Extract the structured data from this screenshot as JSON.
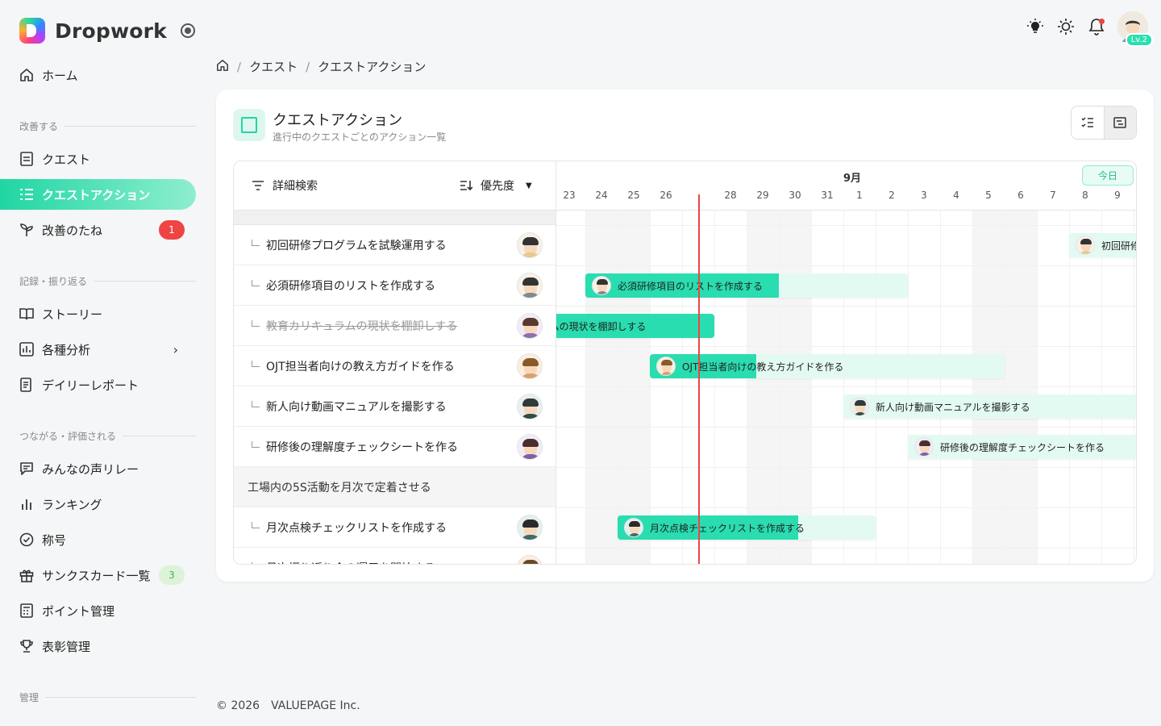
{
  "app": {
    "name": "Dropwork"
  },
  "nav": {
    "home": "ホーム",
    "section_improve": "改善する",
    "quest": "クエスト",
    "quest_action": "クエストアクション",
    "seeds": "改善のたね",
    "seeds_badge": "1",
    "section_record": "記録・振り返る",
    "story": "ストーリー",
    "analysis": "各種分析",
    "daily_report": "デイリーレポート",
    "section_connect": "つながる・評価される",
    "voice_relay": "みんなの声リレー",
    "ranking": "ランキング",
    "title": "称号",
    "thanks_list": "サンクスカード一覧",
    "thanks_badge": "3",
    "points": "ポイント管理",
    "awards": "表彰管理",
    "section_admin": "管理"
  },
  "user": {
    "level": "Lv.2"
  },
  "breadcrumb": {
    "quest": "クエスト",
    "current": "クエストアクション"
  },
  "page": {
    "title": "クエストアクション",
    "subtitle": "進行中のクエストごとのアクション一覧"
  },
  "toolbar": {
    "filter": "詳細検索",
    "sort": "優先度"
  },
  "timeline": {
    "month": "9月",
    "today_label": "今日",
    "days": [
      "23",
      "24",
      "25",
      "26",
      "27",
      "28",
      "29",
      "30",
      "31",
      "1",
      "2",
      "3",
      "4",
      "5",
      "6",
      "7",
      "8",
      "9"
    ],
    "today_index": 4
  },
  "rows": [
    {
      "label": "初回研修プログラムを試験運用する",
      "done": false
    },
    {
      "label": "必須研修項目のリストを作成する",
      "done": false
    },
    {
      "label": "教育カリキュラムの現状を棚卸しする",
      "done": true
    },
    {
      "label": "OJT担当者向けの教え方ガイドを作る",
      "done": false
    },
    {
      "label": "新人向け動画マニュアルを撮影する",
      "done": false
    },
    {
      "label": "研修後の理解度チェックシートを作る",
      "done": false
    },
    {
      "group": "工場内の5S活動を月次で定着させる"
    },
    {
      "label": "月次点検チェックリストを作成する",
      "done": false
    },
    {
      "label": "月次振り返り会の運用を開始する",
      "done": false
    }
  ],
  "bars": [
    {
      "label": "初回研修"
    },
    {
      "label": "必須研修項目のリストを作成する"
    },
    {
      "label": "ラムの現状を棚卸しする"
    },
    {
      "label": "OJT担当者向けの教え方ガイドを作る"
    },
    {
      "label": "新人向け動画マニュアルを撮影する"
    },
    {
      "label": "研修後の理解度チェックシートを作る"
    },
    {
      "label": "月次点検チェックリストを作成する"
    }
  ],
  "footer": "© 2026　VALUEPAGE Inc.",
  "colors": {
    "accent": "#1fd6a3",
    "today": "#ef4444",
    "badge_red": "#ef4444"
  }
}
